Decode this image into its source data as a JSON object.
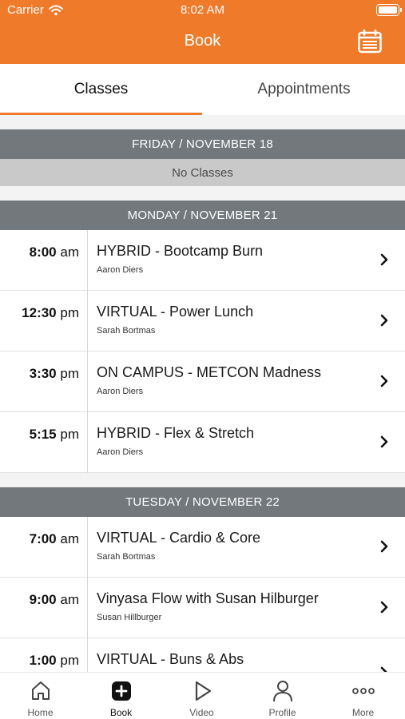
{
  "status_bar": {
    "carrier": "Carrier",
    "time": "8:02 AM"
  },
  "nav": {
    "title": "Book",
    "calendar_icon": "calendar-icon"
  },
  "tabs": [
    {
      "label": "Classes",
      "selected": true
    },
    {
      "label": "Appointments",
      "selected": false
    }
  ],
  "accent_color": "#ef7a2a",
  "days": [
    {
      "header": "FRIDAY / NOVEMBER 18",
      "empty_text": "No Classes",
      "classes": []
    },
    {
      "header": "MONDAY / NOVEMBER 21",
      "classes": [
        {
          "time": "8:00",
          "meridiem": "am",
          "title": "HYBRID - Bootcamp Burn",
          "instructor": "Aaron Diers"
        },
        {
          "time": "12:30",
          "meridiem": "pm",
          "title": "VIRTUAL - Power Lunch",
          "instructor": "Sarah Bortmas"
        },
        {
          "time": "3:30",
          "meridiem": "pm",
          "title": "ON CAMPUS - METCON Madness",
          "instructor": "Aaron Diers"
        },
        {
          "time": "5:15",
          "meridiem": "pm",
          "title": "HYBRID - Flex & Stretch",
          "instructor": "Aaron Diers"
        }
      ]
    },
    {
      "header": "TUESDAY / NOVEMBER 22",
      "classes": [
        {
          "time": "7:00",
          "meridiem": "am",
          "title": "VIRTUAL - Cardio & Core",
          "instructor": "Sarah Bortmas"
        },
        {
          "time": "9:00",
          "meridiem": "am",
          "title": "Vinyasa Flow with Susan Hilburger",
          "instructor": "Susan Hillburger"
        },
        {
          "time": "1:00",
          "meridiem": "pm",
          "title": "VIRTUAL - Buns & Abs",
          "instructor": ""
        }
      ]
    }
  ],
  "tabbar": [
    {
      "label": "Home",
      "icon": "home-icon",
      "active": false
    },
    {
      "label": "Book",
      "icon": "add-square-icon",
      "active": true
    },
    {
      "label": "Video",
      "icon": "play-icon",
      "active": false
    },
    {
      "label": "Profile",
      "icon": "person-icon",
      "active": false
    },
    {
      "label": "More",
      "icon": "more-dots-icon",
      "active": false
    }
  ]
}
